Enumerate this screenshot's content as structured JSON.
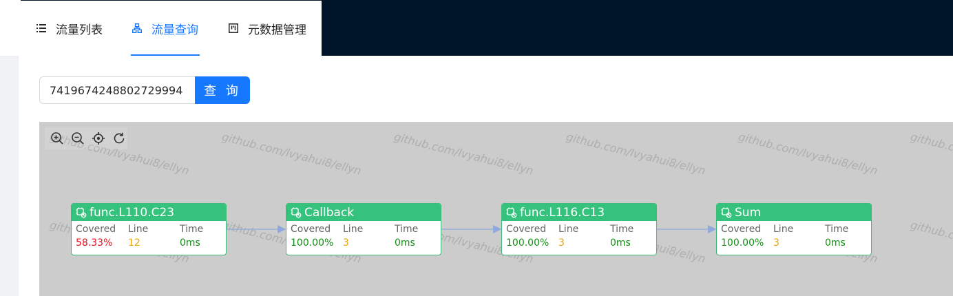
{
  "nav": {
    "tabs": [
      {
        "label": "流量列表",
        "icon": "list-icon",
        "active": false
      },
      {
        "label": "流量查询",
        "icon": "cluster-icon",
        "active": true
      },
      {
        "label": "元数据管理",
        "icon": "project-icon",
        "active": false
      }
    ]
  },
  "search": {
    "value": "7419674248802729994",
    "button_label": "查 询"
  },
  "toolbar": {
    "tools": [
      "zoom-in-icon",
      "zoom-out-icon",
      "locate-icon",
      "reload-icon"
    ]
  },
  "watermark": "github.com/lvyahui8/ellyn",
  "graph": {
    "columns": [
      "Covered",
      "Line",
      "Time"
    ],
    "nodes": [
      {
        "title": "func.L110.C23",
        "covered": "58.33%",
        "line": "12",
        "time": "0ms",
        "covered_color": "#e8101f"
      },
      {
        "title": "Callback",
        "covered": "100.00%",
        "line": "3",
        "time": "0ms",
        "covered_color": "#138f13"
      },
      {
        "title": "func.L116.C13",
        "covered": "100.00%",
        "line": "3",
        "time": "0ms",
        "covered_color": "#138f13"
      },
      {
        "title": "Sum",
        "covered": "100.00%",
        "line": "3",
        "time": "0ms",
        "covered_color": "#138f13"
      }
    ]
  },
  "colors": {
    "nav_bg": "#001529",
    "accent": "#1677ff",
    "node_header": "#35c27c",
    "line_value": "#f0a30a",
    "time_value": "#138f13",
    "edge": "#8fa8de"
  }
}
